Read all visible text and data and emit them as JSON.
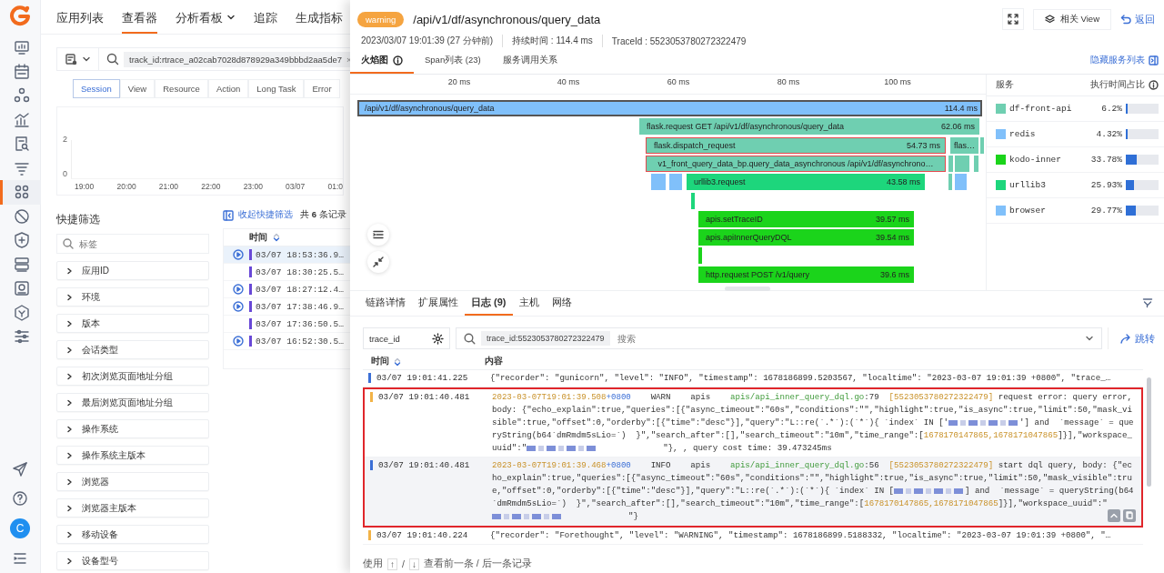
{
  "sidebar": {
    "items": [
      {
        "selected": false
      },
      {
        "selected": false
      },
      {
        "selected": false
      },
      {
        "selected": false
      },
      {
        "selected": false
      },
      {
        "selected": false
      },
      {
        "selected": true
      },
      {
        "selected": false
      },
      {
        "selected": false
      },
      {
        "selected": false
      },
      {
        "selected": false
      },
      {
        "selected": false
      },
      {
        "selected": false
      }
    ],
    "user": {
      "initial": "C"
    }
  },
  "nav": [
    {
      "label": "应用列表",
      "selected": false,
      "dropdown": false
    },
    {
      "label": "查看器",
      "selected": true,
      "dropdown": false
    },
    {
      "label": "分析看板",
      "selected": false,
      "dropdown": true
    },
    {
      "label": "追踪",
      "selected": false,
      "dropdown": false
    },
    {
      "label": "生成指标",
      "selected": false,
      "dropdown": false
    }
  ],
  "query": {
    "chip": "track_id:rtrace_a02cab7028d878929a349bbbd2aa5de7",
    "close": "×"
  },
  "subtabs": [
    {
      "label": "Session",
      "selected": true
    },
    {
      "label": "View",
      "selected": false
    },
    {
      "label": "Resource",
      "selected": false
    },
    {
      "label": "Action",
      "selected": false
    },
    {
      "label": "Long Task",
      "selected": false
    },
    {
      "label": "Error",
      "selected": false
    }
  ],
  "chart": {
    "y_labels": [
      "2",
      "0"
    ],
    "x_labels": [
      "19:00",
      "20:00",
      "21:00",
      "22:00",
      "23:00",
      "03/07",
      "01:0"
    ]
  },
  "quick_filter": {
    "title": "快捷筛选",
    "placeholder": "标签",
    "items": [
      "应用ID",
      "环境",
      "版本",
      "会话类型",
      "初次浏览页面地址分组",
      "最后浏览页面地址分组",
      "操作系统",
      "操作系统主版本",
      "浏览器",
      "浏览器主版本",
      "移动设备",
      "设备型号"
    ]
  },
  "records": {
    "collapse": "收起快捷筛选",
    "count": "共 **6** 条记录",
    "column": "时间",
    "rows": [
      {
        "time": "03/07 18:53:36.9…",
        "replay": true,
        "selected": true
      },
      {
        "time": "03/07 18:30:25.5…",
        "replay": false,
        "selected": false
      },
      {
        "time": "03/07 18:27:12.4…",
        "replay": true,
        "selected": false
      },
      {
        "time": "03/07 17:38:46.9…",
        "replay": true,
        "selected": false
      },
      {
        "time": "03/07 17:36:50.5…",
        "replay": false,
        "selected": false
      },
      {
        "time": "03/07 16:52:30.5…",
        "replay": true,
        "selected": false
      }
    ]
  },
  "drawer": {
    "status": "warning",
    "title": "/api/v1/df/asynchronous/query_data",
    "related": "相关 View",
    "back": "返回",
    "meta": [
      "2023/03/07 19:01:39 (27 分钟前)",
      "持续时间 : 114.4 ms",
      "TraceId : 5523053780272322479"
    ],
    "tabs": [
      {
        "label": "火焰图",
        "selected": true,
        "info": true
      },
      {
        "label": "Span列表 (23)",
        "selected": false,
        "info": false
      },
      {
        "label": "服务调用关系",
        "selected": false,
        "info": false
      }
    ],
    "hide_services": "隐藏服务列表",
    "ticks": [
      "20 ms",
      "40 ms",
      "60 ms",
      "80 ms",
      "100 ms"
    ],
    "spans": [
      {
        "label": "/api/v1/df/asynchronous/query_data",
        "duration": "114.4 ms",
        "color": "#80c0fa",
        "selected": true,
        "error": false
      },
      {
        "label": "flask.request GET /api/v1/df/asynchronous/query_data",
        "duration": "62.06 ms",
        "color": "#6fcfb1",
        "selected": false,
        "error": false
      },
      {
        "label": "flask.dispatch_request",
        "duration": "54.73 ms",
        "color": "#6fcfb1",
        "selected": false,
        "error": true
      },
      {
        "label": "flas…",
        "color": "#6fcfb1",
        "selected": false,
        "error": false
      },
      {
        "color": "#6fcfb1",
        "selected": false,
        "error": false
      },
      {
        "label": "v1_front_query_data_bp.query_data_asynchronous /api/v1/df/asynchrono…",
        "color": "#6fcfb1",
        "selected": false,
        "error": true
      },
      {
        "color": "#6fcfb1",
        "selected": false,
        "error": false
      },
      {
        "color": "#6fcfb1",
        "selected": false,
        "error": false
      },
      {
        "color": "#6fcfb1",
        "selected": false,
        "error": false
      },
      {
        "color": "#80c0fa",
        "selected": false,
        "error": false
      },
      {
        "color": "#80c0fa",
        "selected": false,
        "error": false
      },
      {
        "label": "urllib3.request",
        "duration": "43.58 ms",
        "color": "#1dd67c",
        "selected": false,
        "error": false
      },
      {
        "color": "#6fcfb1",
        "selected": false,
        "error": false
      },
      {
        "color": "#80c0fa",
        "selected": false,
        "error": false
      },
      {
        "color": "#1dd67c",
        "selected": false,
        "error": false
      },
      {
        "label": "apis.setTraceID",
        "duration": "39.57 ms",
        "color": "#1bd41b",
        "selected": false,
        "error": false
      },
      {
        "label": "apis.apiInnerQueryDQL",
        "duration": "39.54 ms",
        "color": "#1bd41b",
        "selected": false,
        "error": false
      },
      {
        "color": "#1bd41b",
        "selected": false,
        "error": false
      },
      {
        "label": "http.request POST /v1/query",
        "duration": "39.6 ms",
        "color": "#1bd41b",
        "selected": false,
        "error": false
      }
    ],
    "services": {
      "col1": "服务",
      "col2": "执行时间占比",
      "rows": [
        {
          "name": "df-front-api",
          "color": "#6fcfb1",
          "share": "6.2%",
          "level": 0.062
        },
        {
          "name": "redis",
          "color": "#80c0fa",
          "share": "4.32%",
          "level": 0.0432
        },
        {
          "name": "kodo-inner",
          "color": "#1bd41b",
          "share": "33.78%",
          "level": 0.3378
        },
        {
          "name": "urllib3",
          "color": "#1dd67c",
          "share": "25.93%",
          "level": 0.2593
        },
        {
          "name": "browser",
          "color": "#80c0fa",
          "share": "29.77%",
          "level": 0.2977
        }
      ]
    },
    "detail_tabs": [
      {
        "label": "链路详情",
        "selected": false
      },
      {
        "label": "扩展属性",
        "selected": false
      },
      {
        "label": "日志 (9)",
        "selected": true
      },
      {
        "label": "主机",
        "selected": false
      },
      {
        "label": "网络",
        "selected": false
      }
    ],
    "log_filter": {
      "field": "trace_id",
      "chip": "trace_id:5523053780272322479",
      "placeholder": "搜索",
      "jump": "跳转"
    },
    "log_columns": [
      "时间",
      "内容"
    ],
    "logs": [
      {
        "time": "03/07 19:01:41.225",
        "color": "#3b6fd6",
        "framed": false,
        "hovered": false,
        "segments": [
          {
            "kind": "text",
            "text": "{\"recorder\": \"gunicorn\", \"level\": \"INFO\", \"timestamp\": 1678186899.5203567, \"localtime\": \"2023-03-07 19:01:39 +0800\", \"trace_…"
          }
        ]
      },
      {
        "time": "03/07 19:01:40.481",
        "color": "#f2b347",
        "framed": true,
        "hovered": false,
        "segments": [
          {
            "kind": "stamp",
            "text": "2023-03-07T19:01:39.508"
          },
          {
            "kind": "zone",
            "text": "+0800"
          },
          {
            "kind": "text",
            "text": "    WARN    apis    "
          },
          {
            "kind": "path",
            "text": "apis/api_inner_query_dql.go"
          },
          {
            "kind": "text",
            "text": ":79  "
          },
          {
            "kind": "stamp",
            "text": "[5523053780272322479]"
          },
          {
            "kind": "text",
            "text": " request error: query error, body: {\"echo_explain\":true,\"queries\":[{\"async_timeout\":\"60s\",\"conditions\":\"\",\"highlight\":true,\"is_async\":true,\"limit\":50,\"mask_visible\":true,\"offset\":0,\"orderby\":[{\"time\":\"desc\"}],\"query\":\"L::re(`.*`):(`*`){ `index` IN ['"
          },
          {
            "kind": "redacted"
          },
          {
            "kind": "text",
            "text": "'] and  `message` = queryString(b64`dmRmdm5sLio=`)  }\",\"search_after\":[],\"search_timeout\":\"10m\",\"time_range\":["
          },
          {
            "kind": "stamp",
            "text": "1678170147865,1678171047865"
          },
          {
            "kind": "text",
            "text": "]}],\"workspace_uuid\":\""
          },
          {
            "kind": "redacted"
          },
          {
            "kind": "text",
            "text": "\"}, , query cost time: 39.473245ms"
          }
        ]
      },
      {
        "time": "03/07 19:01:40.481",
        "color": "#3b6fd6",
        "framed": true,
        "hovered": true,
        "segments": [
          {
            "kind": "stamp",
            "text": "2023-03-07T19:01:39.468"
          },
          {
            "kind": "zone",
            "text": "+0800"
          },
          {
            "kind": "text",
            "text": "    INFO    apis    "
          },
          {
            "kind": "path",
            "text": "apis/api_inner_query_dql.go"
          },
          {
            "kind": "text",
            "text": ":56  "
          },
          {
            "kind": "stamp",
            "text": "[5523053780272322479]"
          },
          {
            "kind": "text",
            "text": " start dql query, body: {\"echo_explain\":true,\"queries\":[{\"async_timeout\":\"60s\",\"conditions\":\"\",\"highlight\":true,\"is_async\":true,\"limit\":50,\"mask_visible\":true,\"offset\":0,\"orderby\":[{\"time\":\"desc\"}],\"query\":\"L::re(`.*`):(`*`){ `index` IN ["
          },
          {
            "kind": "redacted"
          },
          {
            "kind": "text",
            "text": "] and  `message` = queryString(b64`dmRmdm5sLio=`)  }\",\"search_after\":[],\"search_timeout\":\"10m\",\"time_range\":["
          },
          {
            "kind": "stamp",
            "text": "1678170147865,1678171047865"
          },
          {
            "kind": "text",
            "text": "]}],\"workspace_uuid\":\""
          },
          {
            "kind": "redacted"
          },
          {
            "kind": "text",
            "text": "\"}"
          }
        ]
      },
      {
        "time": "03/07 19:01:40.224",
        "color": "#f2b347",
        "framed": false,
        "hovered": false,
        "segments": [
          {
            "kind": "text",
            "text": "{\"recorder\": \"Forethought\", \"level\": \"WARNING\", \"timestamp\": 1678186899.5188332, \"localtime\": \"2023-03-07 19:01:39 +0800\", \"…"
          }
        ]
      }
    ],
    "footer": {
      "prefix": "使用",
      "up": "↑",
      "sep": "/",
      "down": "↓",
      "hint": "查看前一条 / 后一条记录"
    }
  }
}
